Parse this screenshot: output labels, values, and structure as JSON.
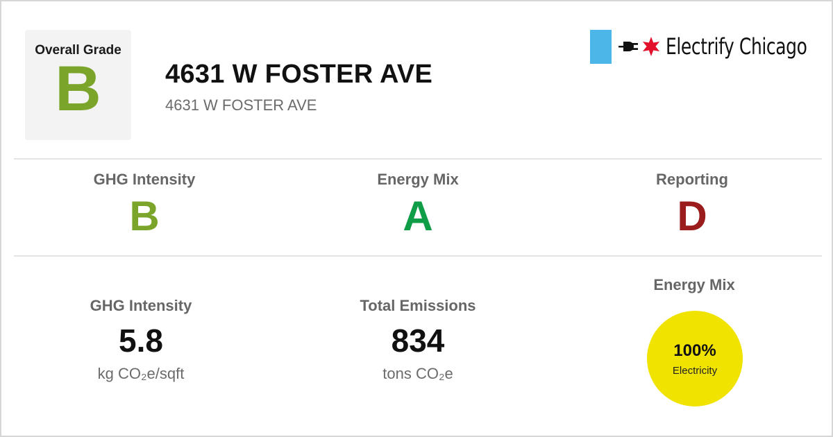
{
  "header": {
    "overall_grade_label": "Overall Grade",
    "overall_grade": "B",
    "title": "4631 W FOSTER AVE",
    "subtitle": "4631 W FOSTER AVE",
    "brand_name": "Electrify Chicago"
  },
  "colors": {
    "grade_b": "#7aa52a",
    "grade_a": "#0f9d48",
    "grade_d": "#9b1c1c",
    "brand_blue": "#4db6e8",
    "brand_red": "#e3102b",
    "mix_yellow": "#f1e300"
  },
  "grades": [
    {
      "label": "GHG Intensity",
      "grade": "B"
    },
    {
      "label": "Energy Mix",
      "grade": "A"
    },
    {
      "label": "Reporting",
      "grade": "D"
    }
  ],
  "stats": {
    "ghg_intensity": {
      "label": "GHG Intensity",
      "value": "5.8",
      "unit": "kg CO₂e/sqft"
    },
    "total_emissions": {
      "label": "Total Emissions",
      "value": "834",
      "unit": "tons CO₂e"
    }
  },
  "energy_mix": {
    "label": "Energy Mix",
    "percent": "100%",
    "source": "Electricity"
  },
  "icons": [
    "plug-icon",
    "chicago-star-icon"
  ]
}
